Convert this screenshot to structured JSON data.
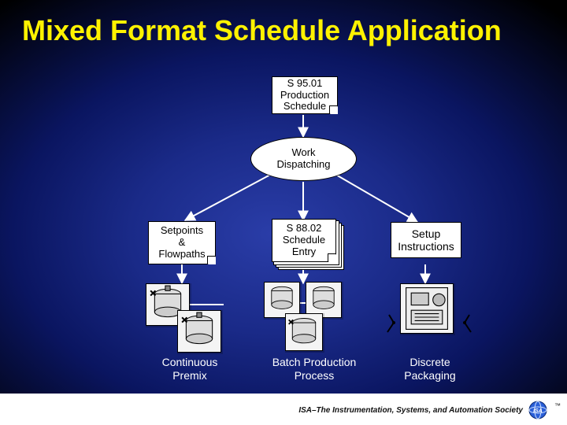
{
  "title": "Mixed Format Schedule Application",
  "nodes": {
    "production_schedule": "S 95.01\nProduction\nSchedule",
    "work_dispatching": "Work\nDispatching",
    "setpoints": "Setpoints\n&\nFlowpaths",
    "schedule_entry": "S 88.02\nSchedule\nEntry",
    "setup_instructions": "Setup\nInstructions"
  },
  "labels": {
    "continuous": "Continuous\nPremix",
    "batch": "Batch Production\nProcess",
    "discrete": "Discrete\nPackaging"
  },
  "footer": "ISA–The Instrumentation, Systems, and Automation Society"
}
